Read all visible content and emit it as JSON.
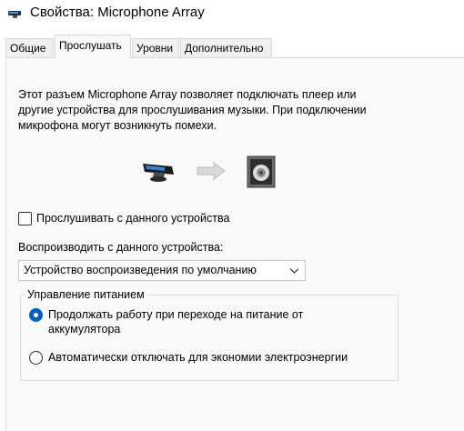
{
  "window": {
    "title": "Свойства: Microphone Array",
    "icon": "microphone-array-icon"
  },
  "tabs": [
    {
      "label": "Общие",
      "active": false
    },
    {
      "label": "Прослушать",
      "active": true
    },
    {
      "label": "Уровни",
      "active": false
    },
    {
      "label": "Дополнительно",
      "active": false
    }
  ],
  "listen": {
    "description": "Этот разъем Microphone Array позволяет подключать плеер или другие устройства для прослушивания музыки. При подключении микрофона могут возникнуть помехи.",
    "illustration": {
      "source_icon": "microphone-array-icon",
      "arrow_icon": "arrow-right-icon",
      "target_icon": "speaker-icon"
    },
    "listen_checkbox": {
      "label": "Прослушивать с данного устройства",
      "checked": false
    },
    "playback_label": "Воспроизводить с данного устройства:",
    "playback_select": {
      "value": "Устройство воспроизведения по умолчанию"
    },
    "power": {
      "legend": "Управление питанием",
      "options": [
        {
          "label": "Продолжать работу при переходе на питание от аккумулятора",
          "checked": true
        },
        {
          "label": "Автоматически отключать для экономии электроэнергии",
          "checked": false
        }
      ]
    }
  },
  "colors": {
    "accent": "#005fb8",
    "panel_bg": "#f9f9f9",
    "tab_bg": "#f0f0f0"
  }
}
